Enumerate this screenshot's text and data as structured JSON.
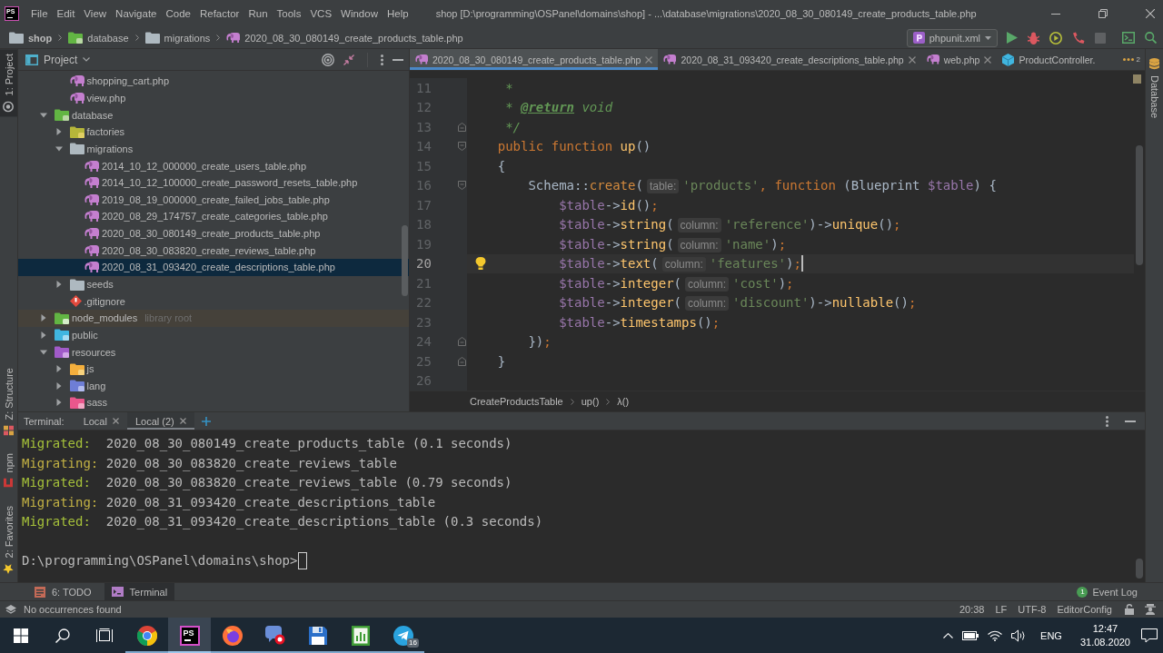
{
  "title_bar": {
    "logo": "PS",
    "menu": [
      "File",
      "Edit",
      "View",
      "Navigate",
      "Code",
      "Refactor",
      "Run",
      "Tools",
      "VCS",
      "Window",
      "Help"
    ],
    "title": "shop [D:\\programming\\OSPanel\\domains\\shop] - ...\\database\\migrations\\2020_08_30_080149_create_products_table.php"
  },
  "nav_bar": {
    "breadcrumbs": [
      {
        "label": "shop",
        "kind": "project"
      },
      {
        "label": "database",
        "kind": "database"
      },
      {
        "label": "migrations",
        "kind": "folder"
      },
      {
        "label": "2020_08_30_080149_create_products_table.php",
        "kind": "php"
      }
    ],
    "run_config": "phpunit.xml"
  },
  "tool_strips": {
    "left_top": [
      {
        "label": "1: Project",
        "kind": "project",
        "selected": true
      }
    ],
    "left_bottom": [
      {
        "label": "Z: Structure",
        "kind": "structure",
        "selected": false
      },
      {
        "label": "npm",
        "kind": "npm",
        "selected": false
      },
      {
        "label": "2: Favorites",
        "kind": "favorites",
        "selected": false
      }
    ],
    "right": [
      {
        "label": "Database",
        "kind": "database",
        "selected": false
      }
    ]
  },
  "project_panel": {
    "title": "Project",
    "tree": {
      "hidden_parent_items": [
        {
          "name": "shopping_cart.php",
          "kind": "php",
          "selected": false
        },
        {
          "name": "view.php",
          "kind": "php",
          "selected": false
        }
      ],
      "items": [
        {
          "name": "database",
          "kind": "database",
          "expanded": true,
          "selected": false,
          "children": [
            {
              "name": "factories",
              "kind": "factories",
              "expanded": false,
              "selected": false
            },
            {
              "name": "migrations",
              "kind": "folder",
              "expanded": true,
              "selected": false,
              "children": [
                {
                  "name": "2014_10_12_000000_create_users_table.php",
                  "kind": "php",
                  "selected": false
                },
                {
                  "name": "2014_10_12_100000_create_password_resets_table.php",
                  "kind": "php",
                  "selected": false
                },
                {
                  "name": "2019_08_19_000000_create_failed_jobs_table.php",
                  "kind": "php",
                  "selected": false
                },
                {
                  "name": "2020_08_29_174757_create_categories_table.php",
                  "kind": "php",
                  "selected": false
                },
                {
                  "name": "2020_08_30_080149_create_products_table.php",
                  "kind": "php",
                  "selected": false
                },
                {
                  "name": "2020_08_30_083820_create_reviews_table.php",
                  "kind": "php",
                  "selected": false
                },
                {
                  "name": "2020_08_31_093420_create_descriptions_table.php",
                  "kind": "php",
                  "selected": true
                }
              ]
            },
            {
              "name": "seeds",
              "kind": "folder",
              "expanded": false,
              "selected": false
            },
            {
              "name": ".gitignore",
              "kind": "gitignore",
              "selected": false
            }
          ]
        },
        {
          "name": "node_modules",
          "kind": "library",
          "expanded": false,
          "selected": false,
          "note": "library root"
        },
        {
          "name": "public",
          "kind": "web",
          "expanded": false,
          "selected": false
        },
        {
          "name": "resources",
          "kind": "resources",
          "expanded": true,
          "selected": false,
          "children": [
            {
              "name": "js",
              "kind": "js",
              "expanded": false,
              "selected": false
            },
            {
              "name": "lang",
              "kind": "lang",
              "expanded": false,
              "selected": false
            },
            {
              "name": "sass",
              "kind": "sass",
              "expanded": false,
              "selected": false
            }
          ]
        }
      ]
    }
  },
  "editor": {
    "tabs": [
      {
        "label": "2020_08_30_080149_create_products_table.php",
        "kind": "php",
        "selected": true,
        "closable": true
      },
      {
        "label": "2020_08_31_093420_create_descriptions_table.php",
        "kind": "php",
        "selected": false,
        "closable": true
      },
      {
        "label": "web.php",
        "kind": "php",
        "selected": false,
        "closable": true
      },
      {
        "label": "ProductController.",
        "kind": "class",
        "selected": false,
        "closable": false
      }
    ],
    "more_tabs": "2",
    "lines": [
      {
        "number": "11",
        "current": false,
        "tokens": [
          {
            "kind": "comment",
            "text": "     *"
          }
        ]
      },
      {
        "number": "12",
        "current": false,
        "tokens": [
          {
            "kind": "comment",
            "text": "     * "
          },
          {
            "kind": "doctag",
            "text": "@return"
          },
          {
            "kind": "comment",
            "text": " void"
          }
        ]
      },
      {
        "number": "13",
        "current": false,
        "fold_end": true,
        "tokens": [
          {
            "kind": "comment",
            "text": "     */"
          }
        ]
      },
      {
        "number": "14",
        "current": false,
        "fold_start": true,
        "tokens": [
          {
            "kind": "keyword",
            "text": "    public function "
          },
          {
            "kind": "function",
            "text": "up"
          },
          {
            "kind": "plain",
            "text": "()"
          }
        ]
      },
      {
        "number": "15",
        "current": false,
        "tokens": [
          {
            "kind": "plain",
            "text": "    {"
          }
        ]
      },
      {
        "number": "16",
        "current": false,
        "fold_start": true,
        "tokens": [
          {
            "kind": "plain",
            "text": "        Schema::"
          },
          {
            "kind": "static",
            "text": "create"
          },
          {
            "kind": "plain",
            "text": "("
          },
          {
            "kind": "hint",
            "text": "table:"
          },
          {
            "kind": "string",
            "text": "'products'"
          },
          {
            "kind": "punct",
            "text": ", "
          },
          {
            "kind": "keyword",
            "text": "function "
          },
          {
            "kind": "plain",
            "text": "(Blueprint "
          },
          {
            "kind": "variable",
            "text": "$table"
          },
          {
            "kind": "plain",
            "text": ") {"
          }
        ]
      },
      {
        "number": "17",
        "current": false,
        "tokens": [
          {
            "kind": "variable",
            "text": "            $table"
          },
          {
            "kind": "plain",
            "text": "->"
          },
          {
            "kind": "call",
            "text": "id"
          },
          {
            "kind": "plain",
            "text": "()"
          },
          {
            "kind": "punct",
            "text": ";"
          }
        ]
      },
      {
        "number": "18",
        "current": false,
        "tokens": [
          {
            "kind": "variable",
            "text": "            $table"
          },
          {
            "kind": "plain",
            "text": "->"
          },
          {
            "kind": "call",
            "text": "string"
          },
          {
            "kind": "plain",
            "text": "("
          },
          {
            "kind": "hint",
            "text": "column:"
          },
          {
            "kind": "string",
            "text": "'reference'"
          },
          {
            "kind": "plain",
            "text": ")->"
          },
          {
            "kind": "call",
            "text": "unique"
          },
          {
            "kind": "plain",
            "text": "()"
          },
          {
            "kind": "punct",
            "text": ";"
          }
        ]
      },
      {
        "number": "19",
        "current": false,
        "tokens": [
          {
            "kind": "variable",
            "text": "            $table"
          },
          {
            "kind": "plain",
            "text": "->"
          },
          {
            "kind": "call",
            "text": "string"
          },
          {
            "kind": "plain",
            "text": "("
          },
          {
            "kind": "hint",
            "text": "column:"
          },
          {
            "kind": "string",
            "text": "'name'"
          },
          {
            "kind": "plain",
            "text": ")"
          },
          {
            "kind": "punct",
            "text": ";"
          }
        ]
      },
      {
        "number": "20",
        "current": true,
        "tokens": [
          {
            "kind": "variable",
            "text": "            $table"
          },
          {
            "kind": "plain",
            "text": "->"
          },
          {
            "kind": "call",
            "text": "text"
          },
          {
            "kind": "plain",
            "text": "("
          },
          {
            "kind": "hint",
            "text": "column:"
          },
          {
            "kind": "string",
            "text": "'features'"
          },
          {
            "kind": "plain",
            "text": ")"
          },
          {
            "kind": "punct",
            "text": ";"
          }
        ]
      },
      {
        "number": "21",
        "current": false,
        "tokens": [
          {
            "kind": "variable",
            "text": "            $table"
          },
          {
            "kind": "plain",
            "text": "->"
          },
          {
            "kind": "call",
            "text": "integer"
          },
          {
            "kind": "plain",
            "text": "("
          },
          {
            "kind": "hint",
            "text": "column:"
          },
          {
            "kind": "string",
            "text": "'cost'"
          },
          {
            "kind": "plain",
            "text": ")"
          },
          {
            "kind": "punct",
            "text": ";"
          }
        ]
      },
      {
        "number": "22",
        "current": false,
        "tokens": [
          {
            "kind": "variable",
            "text": "            $table"
          },
          {
            "kind": "plain",
            "text": "->"
          },
          {
            "kind": "call",
            "text": "integer"
          },
          {
            "kind": "plain",
            "text": "("
          },
          {
            "kind": "hint",
            "text": "column:"
          },
          {
            "kind": "string",
            "text": "'discount'"
          },
          {
            "kind": "plain",
            "text": ")->"
          },
          {
            "kind": "call",
            "text": "nullable"
          },
          {
            "kind": "plain",
            "text": "()"
          },
          {
            "kind": "punct",
            "text": ";"
          }
        ]
      },
      {
        "number": "23",
        "current": false,
        "tokens": [
          {
            "kind": "variable",
            "text": "            $table"
          },
          {
            "kind": "plain",
            "text": "->"
          },
          {
            "kind": "call",
            "text": "timestamps"
          },
          {
            "kind": "plain",
            "text": "()"
          },
          {
            "kind": "punct",
            "text": ";"
          }
        ]
      },
      {
        "number": "24",
        "current": false,
        "fold_end": true,
        "tokens": [
          {
            "kind": "plain",
            "text": "        })"
          },
          {
            "kind": "punct",
            "text": ";"
          }
        ]
      },
      {
        "number": "25",
        "current": false,
        "fold_end": true,
        "tokens": [
          {
            "kind": "plain",
            "text": "    }"
          }
        ]
      },
      {
        "number": "26",
        "current": false
      }
    ],
    "breadcrumbs": [
      "CreateProductsTable",
      "up()",
      "λ()"
    ]
  },
  "terminal": {
    "title": "Terminal:",
    "tabs": [
      {
        "label": "Local",
        "selected": false
      },
      {
        "label": "Local (2)",
        "selected": true
      }
    ],
    "lines": [
      {
        "kind": "done",
        "label": "Migrated:",
        "text": "2020_08_30_080149_create_products_table (0.1 seconds)"
      },
      {
        "kind": "running",
        "label": "Migrating:",
        "text": "2020_08_30_083820_create_reviews_table"
      },
      {
        "kind": "done",
        "label": "Migrated:",
        "text": "2020_08_30_083820_create_reviews_table (0.79 seconds)"
      },
      {
        "kind": "running",
        "label": "Migrating:",
        "text": "2020_08_31_093420_create_descriptions_table"
      },
      {
        "kind": "done",
        "label": "Migrated:",
        "text": "2020_08_31_093420_create_descriptions_table (0.3 seconds)"
      }
    ],
    "prompt": "D:\\programming\\OSPanel\\domains\\shop>"
  },
  "tool_windows": {
    "items": [
      {
        "label": "6: TODO",
        "kind": "todo",
        "selected": false
      },
      {
        "label": "Terminal",
        "kind": "terminal",
        "selected": true
      }
    ],
    "event_log": {
      "label": "Event Log",
      "count": "1"
    }
  },
  "status_bar": {
    "message": "No occurrences found",
    "fields": [
      "20:38",
      "LF",
      "UTF-8",
      "EditorConfig"
    ]
  },
  "taskbar": {
    "apps": [
      {
        "kind": "circle",
        "running": true,
        "selected": false
      },
      {
        "kind": "ide",
        "label": "PS",
        "running": true,
        "selected": true
      },
      {
        "kind": "flame",
        "running": true,
        "selected": false
      },
      {
        "kind": "bubble",
        "running": true,
        "selected": false
      },
      {
        "kind": "floppy",
        "running": true,
        "selected": false
      },
      {
        "kind": "chart",
        "running": true,
        "selected": false
      },
      {
        "kind": "plane",
        "badge": "16",
        "running": true,
        "selected": false
      }
    ],
    "language": "ENG",
    "time": "12:47",
    "date": "31.08.2020"
  }
}
